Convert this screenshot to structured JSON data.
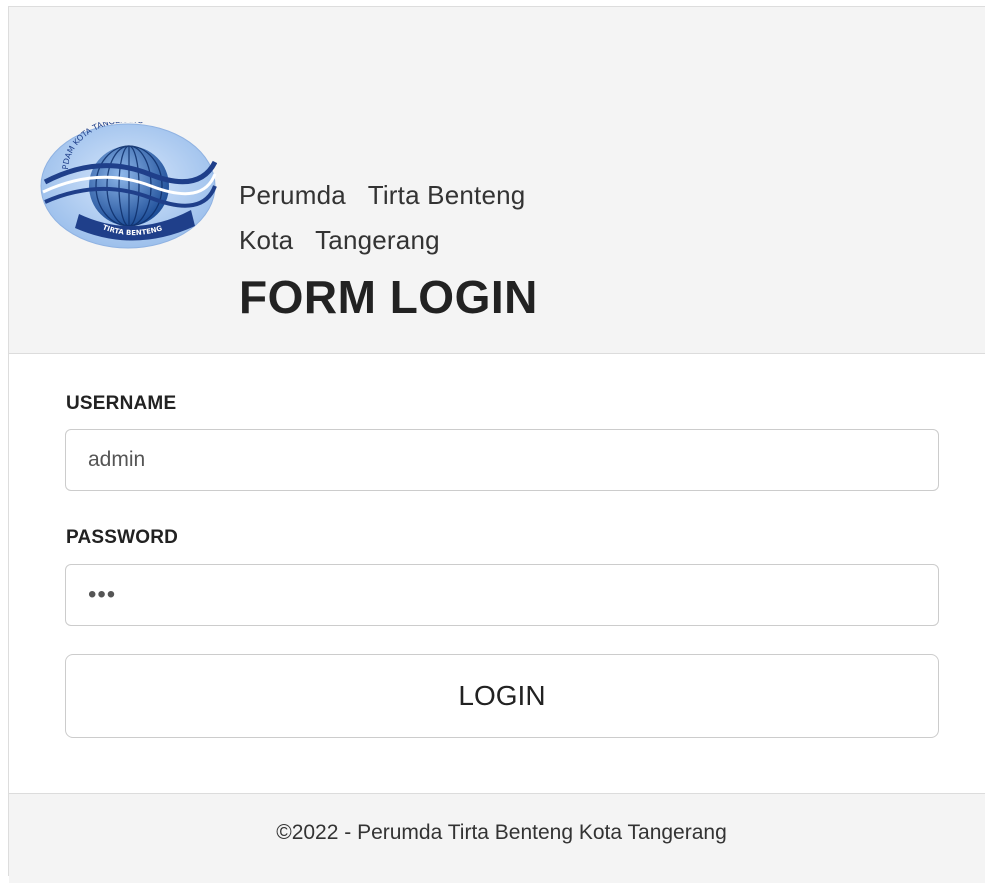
{
  "brand": {
    "logo_text_top": "PDAM KOTA TANGERANG",
    "logo_text_bottom": "TIRTA BENTENG",
    "org_line1": "Perumda   Tirta Benteng",
    "org_line2": "Kota   Tangerang",
    "form_title": "FORM LOGIN",
    "logo_colors": {
      "outer": "#a9c8ef",
      "globe": "#2f6bb8",
      "ribbon": "#1f3f8a"
    }
  },
  "form": {
    "username_label": "USERNAME",
    "username_value": "admin",
    "password_label": "PASSWORD",
    "password_value": "***",
    "login_label": "LOGIN"
  },
  "footer": {
    "copyright": "©2022 - Perumda Tirta Benteng Kota Tangerang"
  }
}
